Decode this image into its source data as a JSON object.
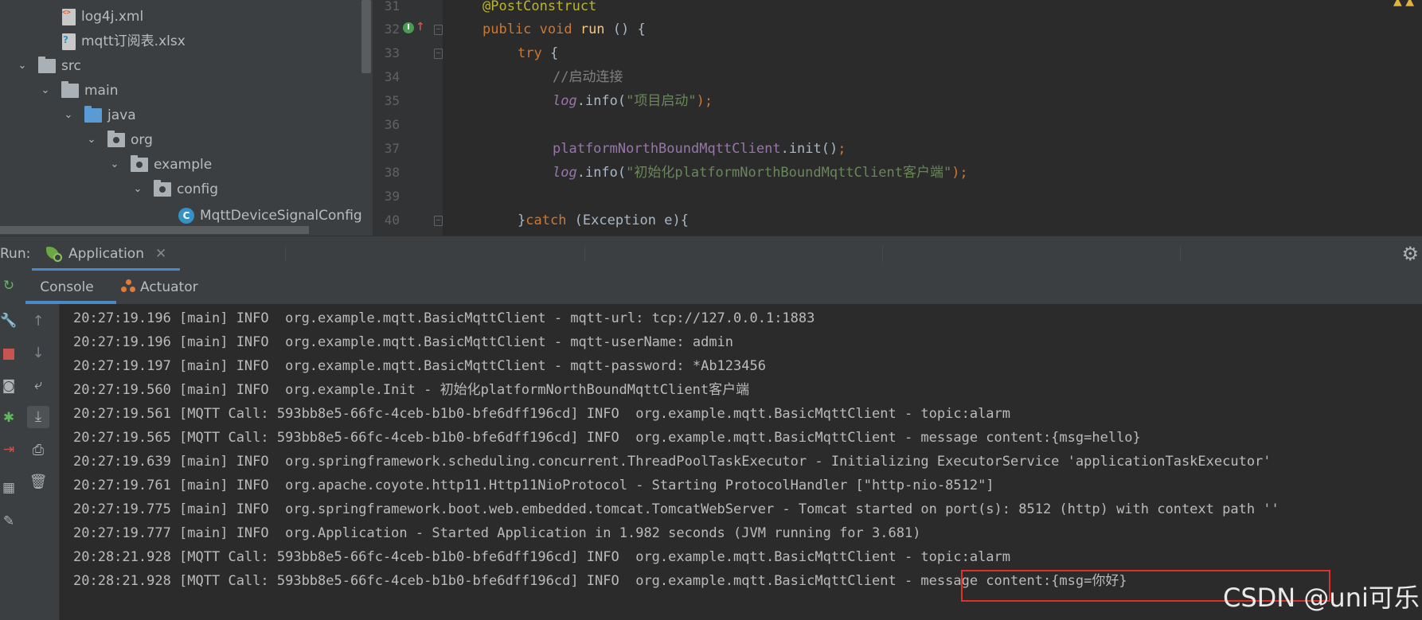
{
  "project_tree": {
    "items": [
      {
        "label": "log4j.xml",
        "icon": "xml-file-icon"
      },
      {
        "label": "mqtt订阅表.xlsx",
        "icon": "xlsx-file-icon"
      },
      {
        "label": "src",
        "icon": "folder-icon"
      },
      {
        "label": "main",
        "icon": "folder-icon"
      },
      {
        "label": "java",
        "icon": "source-folder-icon"
      },
      {
        "label": "org",
        "icon": "package-icon"
      },
      {
        "label": "example",
        "icon": "package-icon"
      },
      {
        "label": "config",
        "icon": "package-icon"
      },
      {
        "label": "MqttDeviceSignalConfig",
        "icon": "class-icon"
      }
    ]
  },
  "editor": {
    "line_numbers": [
      "31",
      "32",
      "33",
      "34",
      "35",
      "36",
      "37",
      "38",
      "39",
      "40"
    ],
    "code": {
      "l31": "@PostConstruct",
      "l32_kw": "public void ",
      "l32_fn": "run",
      "l32_rest": " () {",
      "l33_kw": "try",
      "l33_rest": " {",
      "l34": "//启动连接",
      "l35_obj": "log",
      "l35_call": ".info(",
      "l35_str": "\"项目启动\"",
      "l35_end": ");",
      "l37_obj": "platformNorthBoundMqttClient",
      "l37_call": ".init()",
      "l37_end": ";",
      "l38_obj": "log",
      "l38_call": ".info(",
      "l38_str": "\"初始化platformNorthBoundMqttClient客户端\"",
      "l38_end": ");",
      "l40_open": "}",
      "l40_kw": "catch",
      "l40_rest": " (Exception e){"
    },
    "colors": {
      "keyword": "#cc7832",
      "annotation": "#bbb529",
      "string": "#6a8759",
      "field": "#9876aa",
      "method": "#ffc66d",
      "comment": "#808080"
    }
  },
  "run_window": {
    "label": "Run:",
    "tab_label": "Application",
    "sub_tabs": {
      "console": "Console",
      "actuator": "Actuator"
    }
  },
  "console": {
    "lines": [
      "20:27:19.196 [main] INFO  org.example.mqtt.BasicMqttClient - mqtt-url: tcp://127.0.0.1:1883",
      "20:27:19.196 [main] INFO  org.example.mqtt.BasicMqttClient - mqtt-userName: admin",
      "20:27:19.197 [main] INFO  org.example.mqtt.BasicMqttClient - mqtt-password: *Ab123456",
      "20:27:19.560 [main] INFO  org.example.Init - 初始化platformNorthBoundMqttClient客户端",
      "20:27:19.561 [MQTT Call: 593bb8e5-66fc-4ceb-b1b0-bfe6dff196cd] INFO  org.example.mqtt.BasicMqttClient - topic:alarm",
      "20:27:19.565 [MQTT Call: 593bb8e5-66fc-4ceb-b1b0-bfe6dff196cd] INFO  org.example.mqtt.BasicMqttClient - message content:{msg=hello}",
      "20:27:19.639 [main] INFO  org.springframework.scheduling.concurrent.ThreadPoolTaskExecutor - Initializing ExecutorService 'applicationTaskExecutor'",
      "20:27:19.761 [main] INFO  org.apache.coyote.http11.Http11NioProtocol - Starting ProtocolHandler [\"http-nio-8512\"]",
      "20:27:19.775 [main] INFO  org.springframework.boot.web.embedded.tomcat.TomcatWebServer - Tomcat started on port(s): 8512 (http) with context path ''",
      "20:27:19.777 [main] INFO  org.Application - Started Application in 1.982 seconds (JVM running for 3.681)",
      "20:28:21.928 [MQTT Call: 593bb8e5-66fc-4ceb-b1b0-bfe6dff196cd] INFO  org.example.mqtt.BasicMqttClient - topic:alarm",
      "20:28:21.928 [MQTT Call: 593bb8e5-66fc-4ceb-b1b0-bfe6dff196cd] INFO  org.example.mqtt.BasicMqttClient - message content:{msg=你好}"
    ]
  },
  "watermark": "CSDN @uni可乐"
}
